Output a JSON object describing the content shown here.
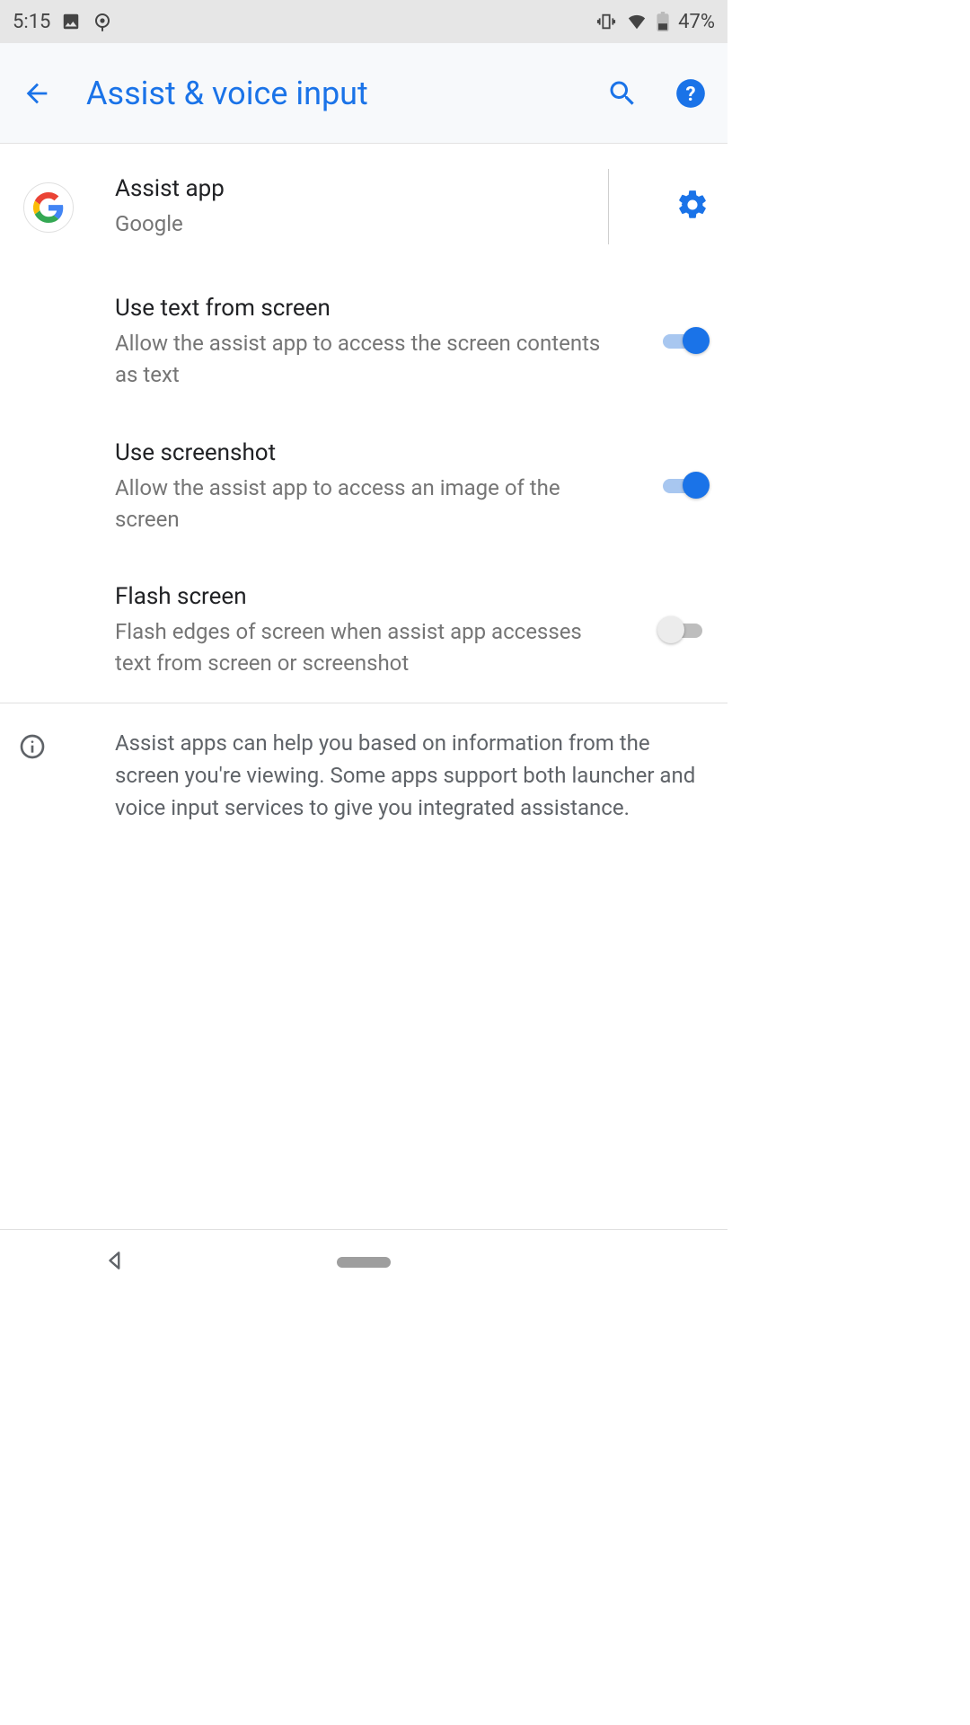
{
  "status": {
    "time": "5:15",
    "battery": "47%"
  },
  "header": {
    "title": "Assist & voice input"
  },
  "assist": {
    "title": "Assist app",
    "value": "Google"
  },
  "settings": [
    {
      "title": "Use text from screen",
      "subtitle": "Allow the assist app to access the screen contents as text",
      "on": true
    },
    {
      "title": "Use screenshot",
      "subtitle": "Allow the assist app to access an image of the screen",
      "on": true
    },
    {
      "title": "Flash screen",
      "subtitle": "Flash edges of screen when assist app accesses text from screen or screenshot",
      "on": false
    }
  ],
  "info": "Assist apps can help you based on information from the screen you're viewing. Some apps support both launcher and voice input services to give you integrated assistance.",
  "colors": {
    "accent": "#1a73e8"
  }
}
